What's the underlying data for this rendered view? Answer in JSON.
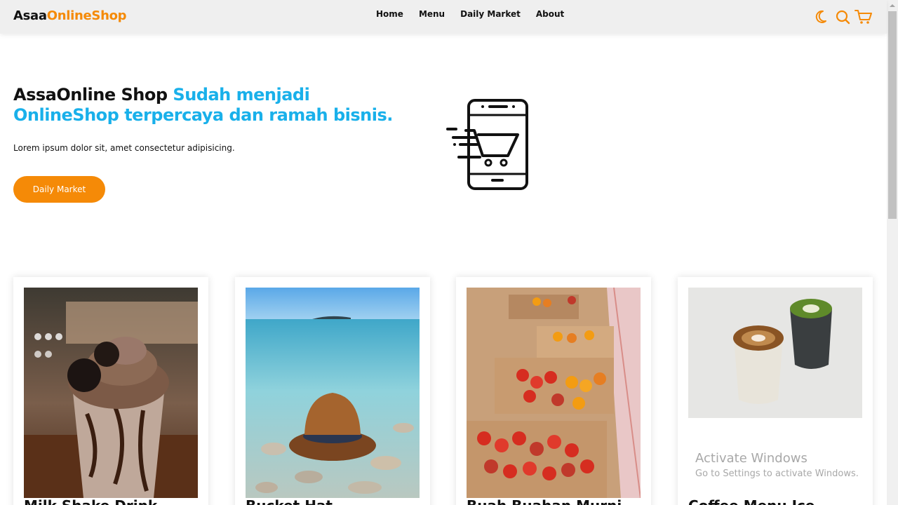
{
  "nav": {
    "brand_part1": "Asaa",
    "brand_part2": "OnlineShop",
    "links": [
      "Home",
      "Menu",
      "Daily Market",
      "About"
    ],
    "icons": [
      "moon-icon",
      "search-icon",
      "cart-icon"
    ]
  },
  "hero": {
    "title_black": "AssaOnline Shop ",
    "title_blue": "Sudah menjadi OnlineShop terpercaya dan ramah bisnis.",
    "subtitle": "Lorem ipsum dolor sit, amet consectetur adipisicing.",
    "button_label": "Daily Market",
    "illustration": "mobile-shopping-cart-icon"
  },
  "cards": [
    {
      "title": "Milk Shake Drink",
      "image": "milkshake-with-oreo"
    },
    {
      "title": "Bucket Hat",
      "image": "hat-in-clear-water"
    },
    {
      "title": "Buah Buahan Murni",
      "image": "tomatoes-in-boxes"
    },
    {
      "title": "Coffee Menu Ice",
      "image": "latte-and-matcha-cups"
    }
  ],
  "watermark": {
    "line1": "Activate Windows",
    "line2": "Go to Settings to activate Windows."
  },
  "colors": {
    "accent_orange": "#f58a07",
    "accent_blue": "#19b0ea",
    "navbar_bg": "#efefef"
  }
}
